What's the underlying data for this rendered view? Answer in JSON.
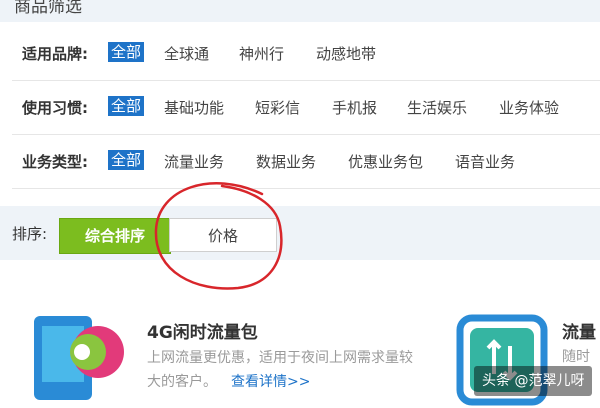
{
  "header": {
    "title": "商品筛选"
  },
  "filters": [
    {
      "label": "适用品牌:",
      "options": [
        "全部",
        "全球通",
        "神州行",
        "动感地带"
      ],
      "selected": "全部"
    },
    {
      "label": "使用习惯:",
      "options": [
        "全部",
        "基础功能",
        "短彩信",
        "手机报",
        "生活娱乐",
        "业务体验"
      ],
      "selected": "全部"
    },
    {
      "label": "业务类型:",
      "options": [
        "全部",
        "流量业务",
        "数据业务",
        "优惠业务包",
        "语音业务"
      ],
      "selected": "全部"
    }
  ],
  "sort": {
    "label": "排序:",
    "options": [
      "综合排序",
      "价格"
    ],
    "active": "综合排序"
  },
  "products": [
    {
      "title": "4G闲时流量包",
      "desc": "上网流量更优惠，适用于夜间上网需求量较大的客户。",
      "link": "查看详情>>"
    },
    {
      "title": "流量",
      "desc": "随时"
    }
  ],
  "watermark": "头条 @范翠儿呀",
  "colors": {
    "accent_blue": "#1e73c8",
    "sort_green": "#7cbd1f",
    "annotation_red": "#d8262b"
  }
}
